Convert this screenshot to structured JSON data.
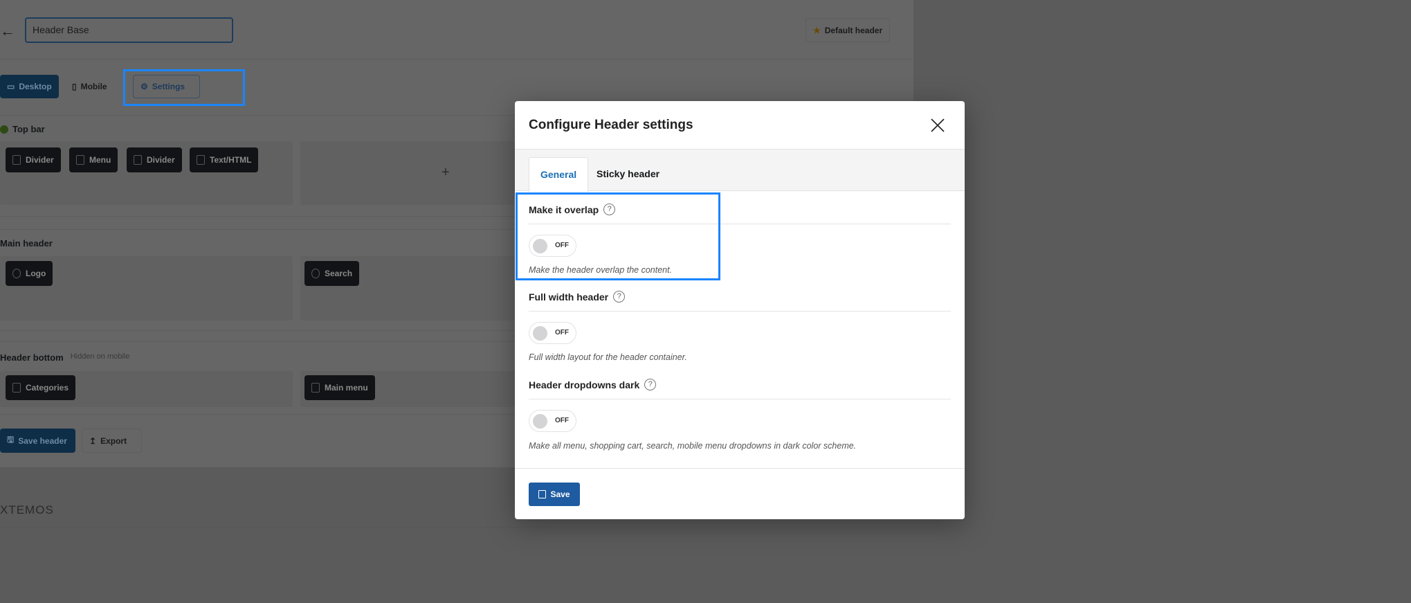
{
  "page": {
    "header_name": "Header Base",
    "default_header_label": "Default header",
    "view_tabs": [
      "Desktop",
      "Mobile",
      "Settings"
    ],
    "sections": {
      "top_bar": {
        "label": "Top bar",
        "items": [
          "Divider",
          "Menu",
          "Divider",
          "Text/HTML"
        ],
        "add_icon": "+"
      },
      "main_header": {
        "label": "Main header",
        "left_items": [
          "Logo"
        ],
        "center_items": [
          "Search"
        ]
      },
      "header_bottom": {
        "label": "Header bottom",
        "note": "Hidden on mobile",
        "left_items": [
          "Categories"
        ],
        "center_items": [
          "Main menu"
        ]
      }
    },
    "save_header_label": "Save header",
    "export_label": "Export",
    "brand": "XTEMOS"
  },
  "modal": {
    "title": "Configure Header settings",
    "tabs": [
      {
        "label": "General",
        "active": true
      },
      {
        "label": "Sticky header",
        "active": false
      }
    ],
    "options": [
      {
        "label": "Make it overlap",
        "state": "OFF",
        "description": "Make the header overlap the content."
      },
      {
        "label": "Full width header",
        "state": "OFF",
        "description": "Full width layout for the header container."
      },
      {
        "label": "Header dropdowns dark",
        "state": "OFF",
        "description": "Make all menu, shopping cart, search, mobile menu dropdowns in dark color scheme."
      }
    ],
    "help_glyph": "?",
    "save_label": "Save"
  },
  "colors": {
    "accent": "#2271b1",
    "highlight": "#1a85ff",
    "save_button": "#1e5ba0",
    "top_bar_dot": "#6fba2c",
    "star": "#f0a500"
  }
}
